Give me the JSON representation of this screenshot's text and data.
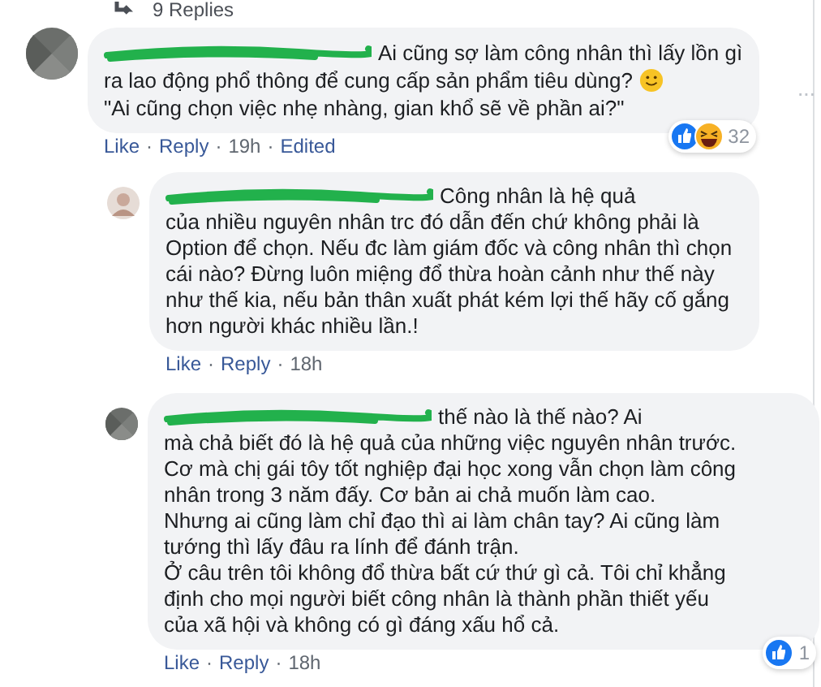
{
  "replies_link": {
    "text": "9 Replies"
  },
  "comments": [
    {
      "avatar": {
        "kind": "gray"
      },
      "text": "Ai cũng sợ làm công nhân thì lấy lồn gì\nra lao động phổ thông để cung cấp sản phẩm tiêu dùng?",
      "emoji": {
        "kind": "smile"
      },
      "text_2": "\"Ai cũng chọn việc nhẹ nhàng, gian khổ sẽ về phần ai?\"",
      "more": "···",
      "reactions": [
        {
          "kind": "like"
        },
        {
          "kind": "haha"
        }
      ],
      "reaction_count": "32",
      "meta": [
        {
          "kind": "link",
          "text": "Like"
        },
        {
          "kind": "sep",
          "text": "·"
        },
        {
          "kind": "link",
          "text": "Reply"
        },
        {
          "kind": "sep",
          "text": "·"
        },
        {
          "kind": "time",
          "text": "19h"
        },
        {
          "kind": "sep",
          "text": "·"
        },
        {
          "kind": "link",
          "text": "Edited"
        }
      ]
    },
    {
      "avatar": {
        "kind": "photo"
      },
      "text": "Công nhân là hệ quả\ncủa nhiều nguyên nhân trc đó dẫn đến chứ không phải là\nOption để chọn. Nếu đc làm giám đốc và công nhân thì chọn\ncái nào? Đừng luôn miệng đổ thừa hoàn cảnh như thế này\nnhư thế kia, nếu bản thân xuất phát kém lợi thế hãy cố gắng\nhơn người khác nhiều lần.!",
      "meta": [
        {
          "kind": "link",
          "text": "Like"
        },
        {
          "kind": "sep",
          "text": "·"
        },
        {
          "kind": "link",
          "text": "Reply"
        },
        {
          "kind": "sep",
          "text": "·"
        },
        {
          "kind": "time",
          "text": "18h"
        }
      ]
    },
    {
      "avatar": {
        "kind": "gray"
      },
      "text": "thế nào là thế nào? Ai\nmà chả biết đó là hệ quả của những việc nguyên nhân trước.\nCơ mà chị gái tôy tốt nghiệp đại học xong vẫn chọn làm công\nnhân trong 3 năm đấy. Cơ bản ai chả muốn làm cao.\nNhưng ai cũng làm chỉ đạo thì ai làm chân tay? Ai cũng làm\ntướng thì lấy đâu ra lính để đánh trận.\nỞ câu trên tôi không đổ thừa bất cứ thứ gì cả. Tôi chỉ khẳng\nđịnh cho mọi người biết công nhân là thành phần thiết yếu\ncủa xã hội và không có gì đáng xấu hổ cả.",
      "reactions": [
        {
          "kind": "like"
        }
      ],
      "reaction_count": "1",
      "meta": [
        {
          "kind": "link",
          "text": "Like"
        },
        {
          "kind": "sep",
          "text": "·"
        },
        {
          "kind": "link",
          "text": "Reply"
        },
        {
          "kind": "sep",
          "text": "·"
        },
        {
          "kind": "time",
          "text": "18h"
        }
      ]
    }
  ]
}
